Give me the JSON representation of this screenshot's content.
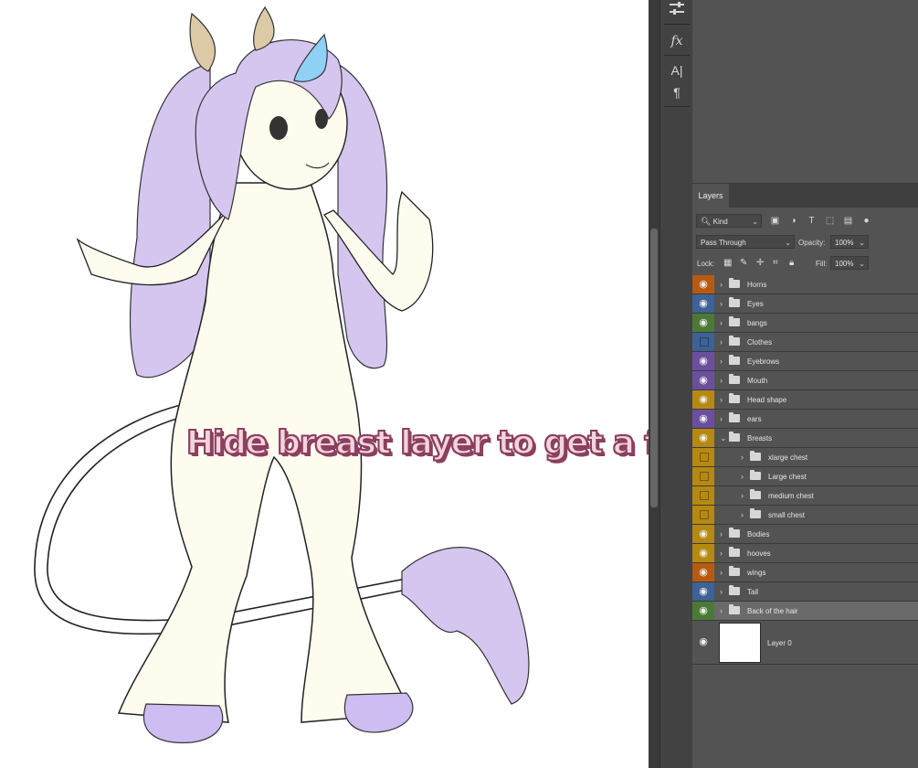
{
  "overlay": {
    "caption": "Hide breast layer to get a flat chest!"
  },
  "toolbar": {
    "icons": [
      "adjustments-icon",
      "fx-icon",
      "character-icon",
      "paragraph-icon"
    ],
    "fx_label": "fx",
    "char_label": "A|",
    "para_label": "¶"
  },
  "panel": {
    "tab": "Layers",
    "filter": {
      "kind": "Kind"
    },
    "blend_mode": "Pass Through",
    "opacity_label": "Opacity:",
    "opacity_value": "100%",
    "lock_label": "Lock:",
    "fill_label": "Fill:",
    "fill_value": "100%"
  },
  "colors": {
    "orange": "#b65a12",
    "blue": "#3e6294",
    "green": "#4a7a36",
    "violet": "#6b4f9e",
    "gold": "#b68a12",
    "selection": "#6a6a6a"
  },
  "layers": [
    {
      "name": "Horns",
      "color": "orange",
      "visible": true,
      "indent": 0,
      "expanded": false
    },
    {
      "name": "Eyes",
      "color": "blue",
      "visible": true,
      "indent": 0,
      "expanded": false
    },
    {
      "name": "bangs",
      "color": "green",
      "visible": true,
      "indent": 0,
      "expanded": false
    },
    {
      "name": "Clothes",
      "color": "blue",
      "visible": false,
      "indent": 0,
      "expanded": false
    },
    {
      "name": "Eyebrows",
      "color": "violet",
      "visible": true,
      "indent": 0,
      "expanded": false
    },
    {
      "name": "Mouth",
      "color": "violet",
      "visible": true,
      "indent": 0,
      "expanded": false
    },
    {
      "name": "Head shape",
      "color": "gold",
      "visible": true,
      "indent": 0,
      "expanded": false
    },
    {
      "name": "ears",
      "color": "violet",
      "visible": true,
      "indent": 0,
      "expanded": false
    },
    {
      "name": "Breasts",
      "color": "gold",
      "visible": true,
      "indent": 0,
      "expanded": true
    },
    {
      "name": "xlarge chest",
      "color": "gold",
      "visible": false,
      "indent": 1,
      "expanded": false
    },
    {
      "name": "Large chest",
      "color": "gold",
      "visible": false,
      "indent": 1,
      "expanded": false
    },
    {
      "name": "medium chest",
      "color": "gold",
      "visible": false,
      "indent": 1,
      "expanded": false
    },
    {
      "name": "small chest",
      "color": "gold",
      "visible": false,
      "indent": 1,
      "expanded": false
    },
    {
      "name": "Bodies",
      "color": "gold",
      "visible": true,
      "indent": 0,
      "expanded": false
    },
    {
      "name": "hooves",
      "color": "gold",
      "visible": true,
      "indent": 0,
      "expanded": false
    },
    {
      "name": "wings",
      "color": "orange",
      "visible": true,
      "indent": 0,
      "expanded": false
    },
    {
      "name": "Tail",
      "color": "blue",
      "visible": true,
      "indent": 0,
      "expanded": false
    },
    {
      "name": "Back of the hair",
      "color": "green",
      "visible": true,
      "indent": 0,
      "expanded": false,
      "selected": true
    }
  ],
  "base_layer": {
    "name": "Layer 0",
    "visible": true
  }
}
